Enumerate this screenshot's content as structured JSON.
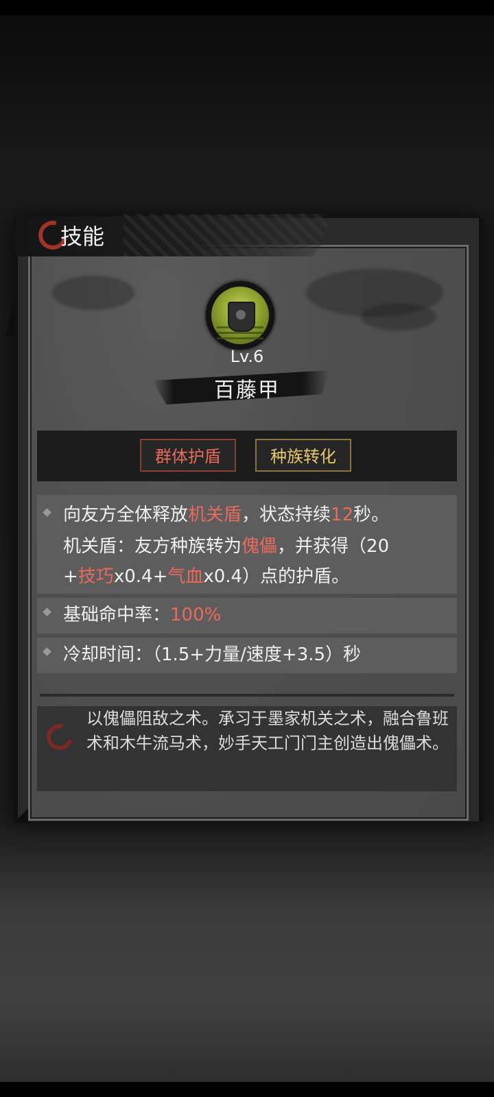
{
  "header": {
    "title": "技能"
  },
  "skill": {
    "icon": "shield-skill-icon",
    "level": "Lv.6",
    "name": "百藤甲"
  },
  "tags": [
    {
      "label": "群体护盾",
      "color": "#e86a5c"
    },
    {
      "label": "种族转化",
      "color": "#e8c770"
    }
  ],
  "description": {
    "line1_a": "向友方全体释放",
    "line1_hl": "机关盾",
    "line1_b": "，状态持续",
    "line1_num": "12",
    "line1_c": "秒。",
    "line2_a": "机关盾：友方种族转为",
    "line2_hl": "傀儡",
    "line2_b": "，并获得（20",
    "line3_a": "+",
    "line3_hl1": "技巧",
    "line3_b": "x0.4+",
    "line3_hl2": "气血",
    "line3_c": "x0.4）点的护盾。"
  },
  "hit_rate": {
    "label": "基础命中率：",
    "value": "100%"
  },
  "cooldown": {
    "label": "冷却时间：",
    "value": "（1.5+力量/速度+3.5）秒"
  },
  "lore": "以傀儡阻敌之术。承习于墨家机关之术，融合鲁班术和木牛流马术，妙手天工门门主创造出傀儡术。",
  "colors": {
    "highlight": "#ea6a5d",
    "gold": "#e8c770",
    "accent_ring": "#a0332b"
  }
}
